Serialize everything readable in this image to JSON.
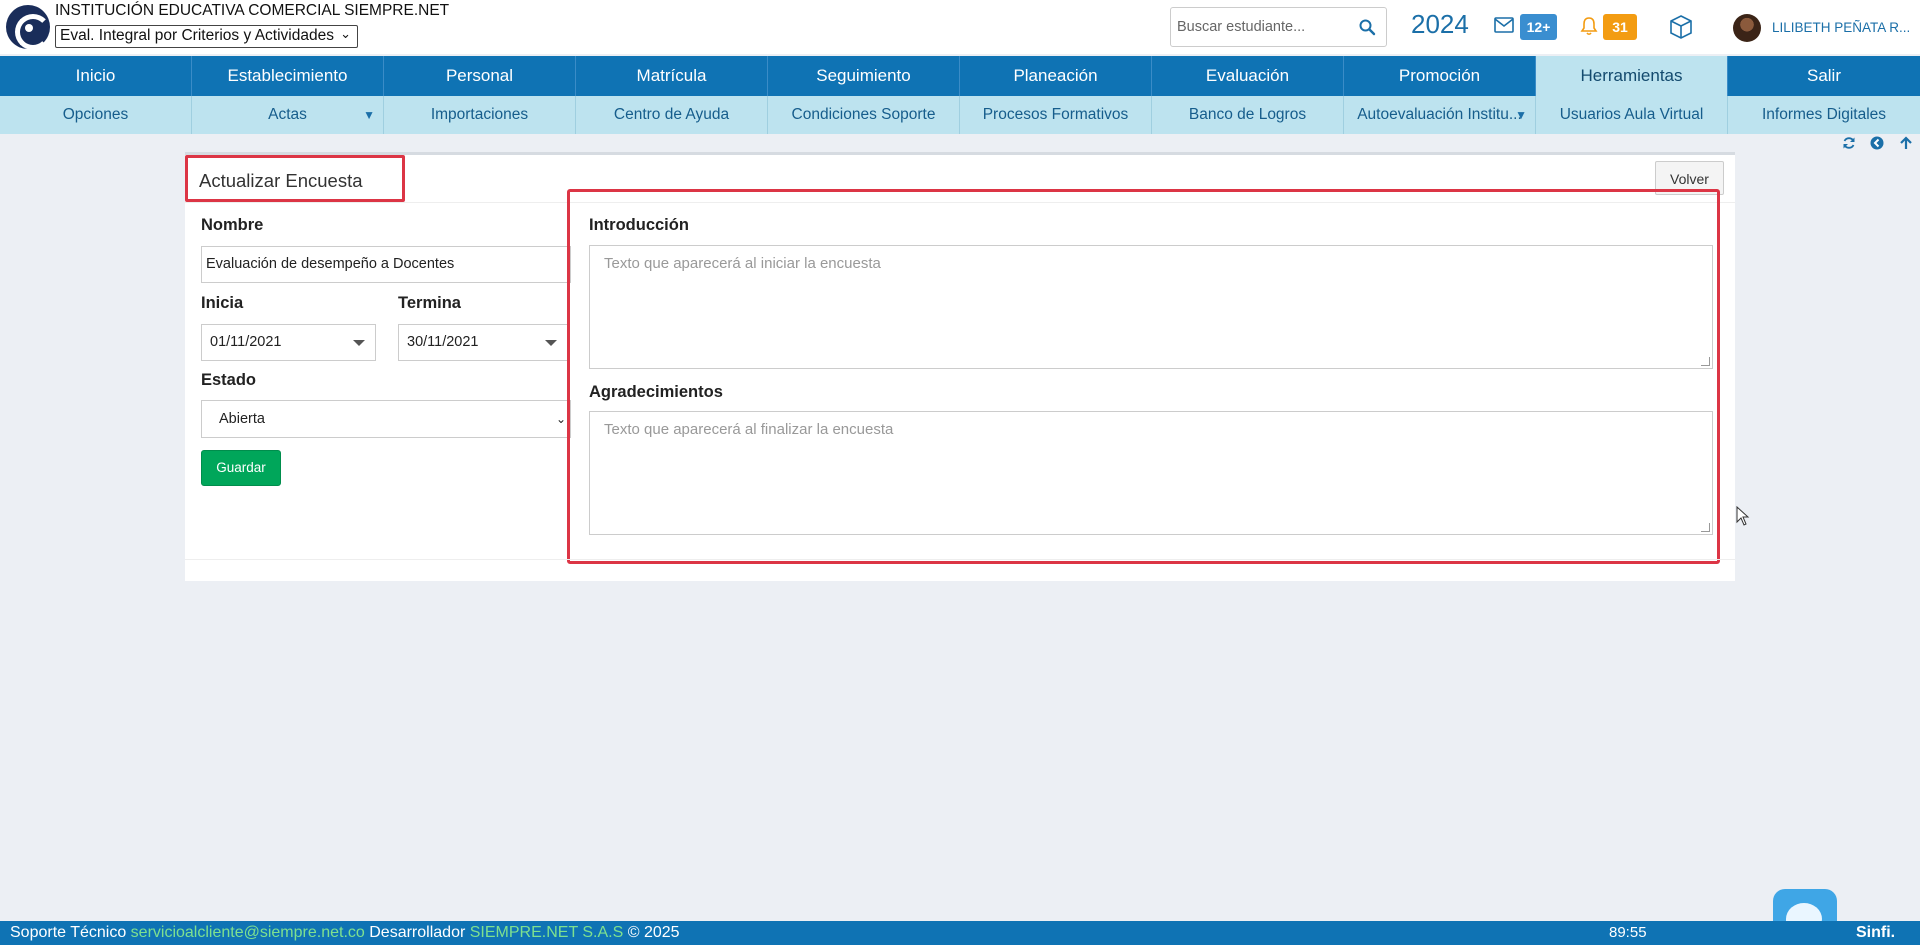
{
  "header": {
    "school_name": "INSTITUCIÓN EDUCATIVA COMERCIAL SIEMPRE.NET",
    "mode_selected": "Eval. Integral por Criterios y Actividades",
    "search_placeholder": "Buscar estudiante...",
    "year": "2024",
    "mail_badge": "12+",
    "notification_badge": "31",
    "user_name": "LILIBETH PEÑATA R..."
  },
  "main_nav": [
    {
      "label": "Inicio"
    },
    {
      "label": "Establecimiento"
    },
    {
      "label": "Personal"
    },
    {
      "label": "Matrícula"
    },
    {
      "label": "Seguimiento"
    },
    {
      "label": "Planeación"
    },
    {
      "label": "Evaluación"
    },
    {
      "label": "Promoción"
    },
    {
      "label": "Herramientas",
      "active": true
    },
    {
      "label": "Salir"
    }
  ],
  "sub_nav": [
    {
      "label": "Opciones"
    },
    {
      "label": "Actas",
      "dropdown": true
    },
    {
      "label": "Importaciones"
    },
    {
      "label": "Centro de Ayuda"
    },
    {
      "label": "Condiciones Soporte"
    },
    {
      "label": "Procesos Formativos"
    },
    {
      "label": "Banco de Logros"
    },
    {
      "label": "Autoevaluación Institu...",
      "dropdown": true
    },
    {
      "label": "Usuarios Aula Virtual"
    },
    {
      "label": "Informes Digitales"
    }
  ],
  "form": {
    "title": "Actualizar Encuesta",
    "back_button": "Volver",
    "nombre_label": "Nombre",
    "nombre_value": "Evaluación de desempeño a Docentes",
    "inicia_label": "Inicia",
    "inicia_value": "01/11/2021",
    "termina_label": "Termina",
    "termina_value": "30/11/2021",
    "estado_label": "Estado",
    "estado_value": "Abierta",
    "save_button": "Guardar",
    "intro_label": "Introducción",
    "intro_placeholder": "Texto que aparecerá al iniciar la encuesta",
    "thanks_label": "Agradecimientos",
    "thanks_placeholder": "Texto que aparecerá al finalizar la encuesta"
  },
  "footer": {
    "support_label": "Soporte Técnico",
    "support_email": "servicioalcliente@siempre.net.co",
    "developer_label": "Desarrollador",
    "developer_name": "SIEMPRE.NET S.A.S",
    "copyright": "© 2025",
    "timer": "89:55",
    "brand": "Sinfi."
  },
  "colors": {
    "primary": "#0f73b4",
    "subnav": "#bde3ef",
    "highlight": "#dc3545",
    "save": "#00a65a"
  },
  "icons": [
    "logo",
    "search-icon",
    "mail-icon",
    "bell-icon",
    "cube-icon",
    "refresh-icon",
    "back-circle-icon",
    "up-arrow-icon",
    "chat-icon"
  ]
}
